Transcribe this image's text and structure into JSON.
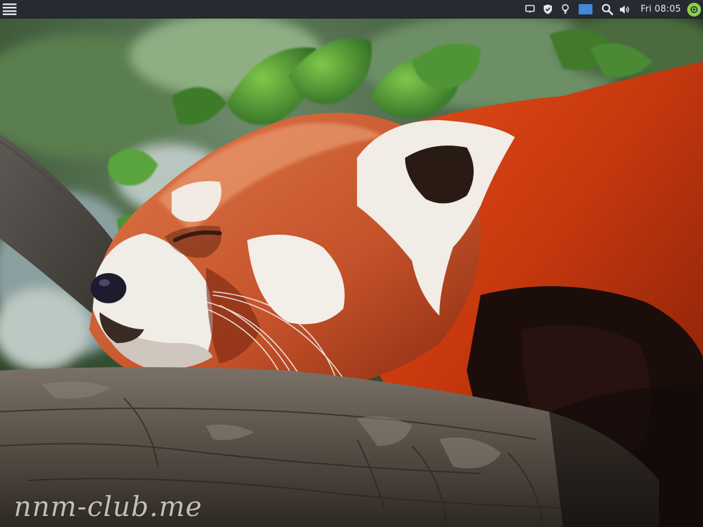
{
  "panel": {
    "menu_icon": "hamburger-menu-icon",
    "tray_icons": [
      "notifications-icon",
      "shield-icon",
      "lightbulb-icon",
      "workspace-icon",
      "search-icon",
      "volume-icon"
    ],
    "clock": "Fri 08:05",
    "session_icon": "power-icon",
    "accent_color": "#8ed04e",
    "panel_color": "#262a31"
  },
  "wallpaper": {
    "subject": "red panda sleeping on a branch",
    "watermark": "nnm-club.me"
  }
}
